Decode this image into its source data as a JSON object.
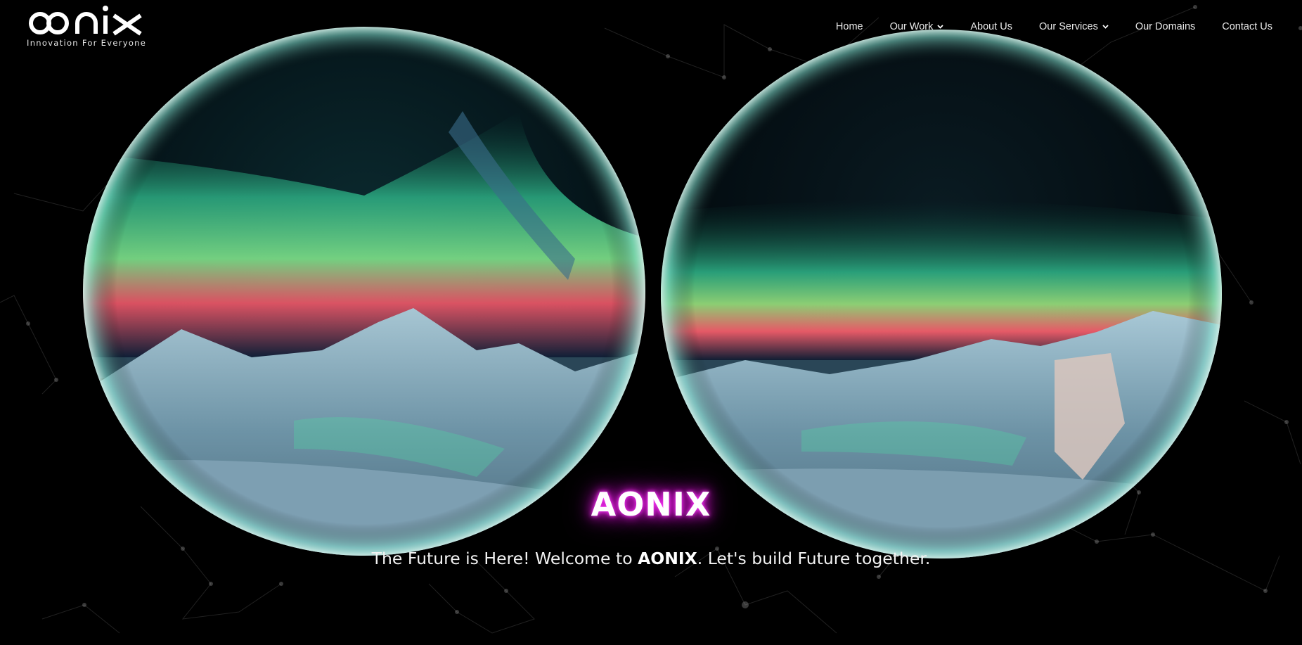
{
  "header": {
    "logo_text": "oonix",
    "logo_tagline": "Innovation For Everyone"
  },
  "nav": [
    {
      "label": "Home",
      "dropdown": false
    },
    {
      "label": "Our Work",
      "dropdown": true
    },
    {
      "label": "About Us",
      "dropdown": false
    },
    {
      "label": "Our Services",
      "dropdown": true
    },
    {
      "label": "Our Domains",
      "dropdown": false
    },
    {
      "label": "Contact Us",
      "dropdown": false
    }
  ],
  "hero": {
    "brand": "AONIX",
    "tagline_before": "The Future is Here! Welcome to ",
    "tagline_bold": "AONIX",
    "tagline_after": ". Let's build Future together."
  },
  "colors": {
    "background": "#000000",
    "aurora_green": "#4fe0a4",
    "aurora_red": "#ff5c6e",
    "neon_magenta": "#e21bdc"
  }
}
